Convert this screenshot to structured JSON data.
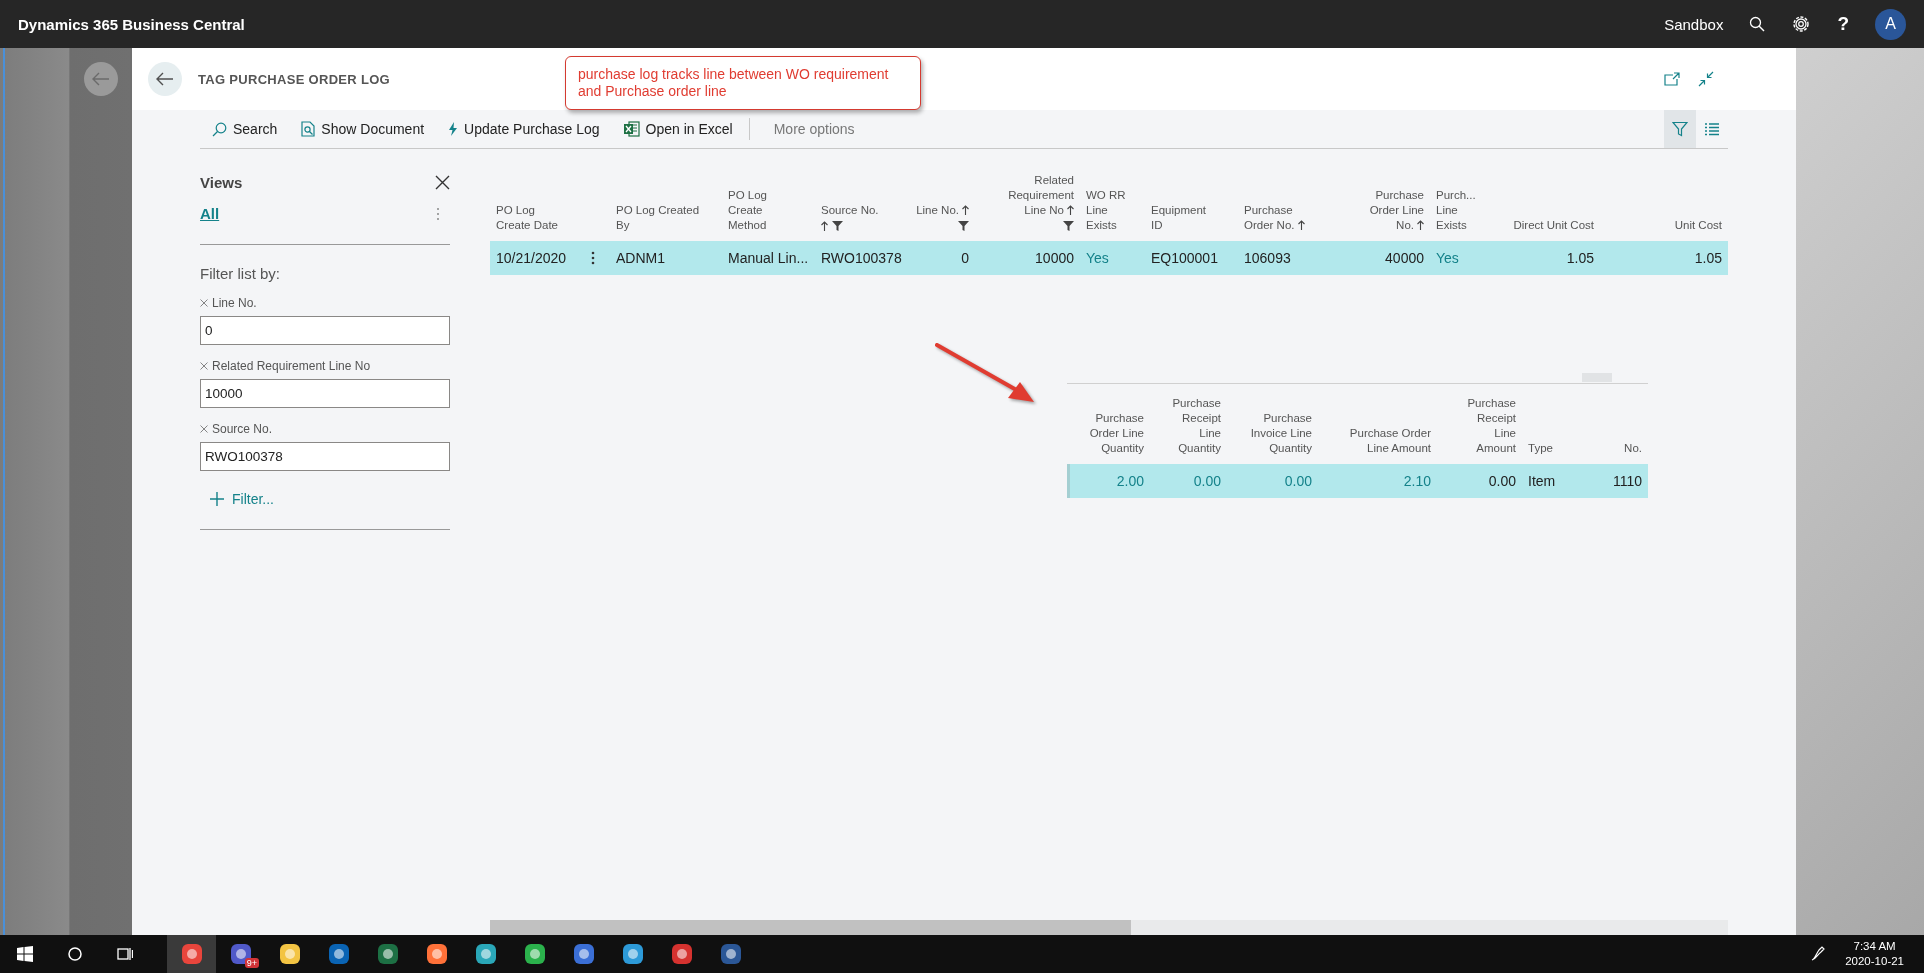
{
  "app": {
    "title": "Dynamics 365 Business Central",
    "environment": "Sandbox",
    "help": "?",
    "avatar": "A"
  },
  "page": {
    "title": "TAG PURCHASE ORDER LOG",
    "annotation": "purchase log tracks line between WO requirement and Purchase order line"
  },
  "actions": [
    {
      "label": "Search",
      "kind": "search"
    },
    {
      "label": "Show Document",
      "kind": "document"
    },
    {
      "label": "Update Purchase Log",
      "kind": "bolt"
    },
    {
      "label": "Open in Excel",
      "kind": "excel"
    },
    {
      "label": "More options",
      "kind": "more"
    }
  ],
  "filter_pane_open": true,
  "views": {
    "title": "Views",
    "items": [
      {
        "label": "All",
        "selected": true
      }
    ]
  },
  "filter_title": "Filter list by:",
  "filters": [
    {
      "label": "Line No.",
      "value": "0"
    },
    {
      "label": "Related Requirement Line No",
      "value": "10000"
    },
    {
      "label": "Source No.",
      "value": "RWO100378"
    }
  ],
  "add_filter": "Filter...",
  "table": {
    "columns": [
      {
        "label": "PO Log\nCreate Date",
        "numeric": false,
        "sorted": false,
        "filtered": false,
        "drilldown": false
      },
      {
        "label": "PO Log Created\nBy",
        "numeric": false,
        "sorted": false,
        "filtered": false,
        "drilldown": false
      },
      {
        "label": "PO Log\nCreate\nMethod",
        "numeric": false,
        "sorted": false,
        "filtered": false,
        "drilldown": false
      },
      {
        "label": "Source No.",
        "numeric": false,
        "sorted": true,
        "filtered": true,
        "drilldown": false
      },
      {
        "label": "Line No.",
        "numeric": true,
        "sorted": true,
        "filtered": true,
        "drilldown": false
      },
      {
        "label": "Related\nRequirement\nLine No",
        "numeric": true,
        "sorted": true,
        "filtered": true,
        "drilldown": false
      },
      {
        "label": "WO RR\nLine\nExists",
        "numeric": false,
        "sorted": false,
        "filtered": false,
        "drilldown": true
      },
      {
        "label": "Equipment\nID",
        "numeric": false,
        "sorted": false,
        "filtered": false,
        "drilldown": false
      },
      {
        "label": "Purchase\nOrder No.",
        "numeric": false,
        "sorted": true,
        "filtered": false,
        "drilldown": false
      },
      {
        "label": "Purchase\nOrder Line\nNo.",
        "numeric": true,
        "sorted": true,
        "filtered": false,
        "drilldown": false
      },
      {
        "label": "Purch...\nLine\nExists",
        "numeric": false,
        "sorted": false,
        "filtered": false,
        "drilldown": true
      },
      {
        "label": "Direct Unit Cost",
        "numeric": true,
        "sorted": false,
        "filtered": false,
        "drilldown": false
      },
      {
        "label": "Unit Cost",
        "numeric": true,
        "sorted": false,
        "filtered": false,
        "drilldown": false
      }
    ],
    "rows": [
      {
        "selected": true,
        "cells": [
          "10/21/2020",
          "ADNM1",
          "Manual Lin...",
          "RWO100378",
          "0",
          "10000",
          "Yes",
          "EQ100001",
          "106093",
          "40000",
          "Yes",
          "1.05",
          "1.05"
        ]
      }
    ]
  },
  "lines_table": {
    "columns": [
      {
        "label": "Purchase\nOrder Line\nQuantity",
        "numeric": true,
        "drilldown": true
      },
      {
        "label": "Purchase\nReceipt\nLine\nQuantity",
        "numeric": true,
        "drilldown": true
      },
      {
        "label": "Purchase\nInvoice Line\nQuantity",
        "numeric": true,
        "drilldown": true
      },
      {
        "label": "Purchase Order\nLine Amount",
        "numeric": true,
        "drilldown": true
      },
      {
        "label": "Purchase\nReceipt\nLine\nAmount",
        "numeric": true,
        "drilldown": false
      },
      {
        "label": "Type",
        "numeric": false,
        "drilldown": false
      },
      {
        "label": "No.",
        "numeric": true,
        "drilldown": false
      }
    ],
    "rows": [
      {
        "selected": true,
        "cells": [
          "2.00",
          "0.00",
          "0.00",
          "2.10",
          "0.00",
          "Item",
          "1110"
        ]
      }
    ]
  },
  "taskbar": {
    "badge": "9+",
    "time": "7:34 AM",
    "date": "2020-10-21"
  }
}
